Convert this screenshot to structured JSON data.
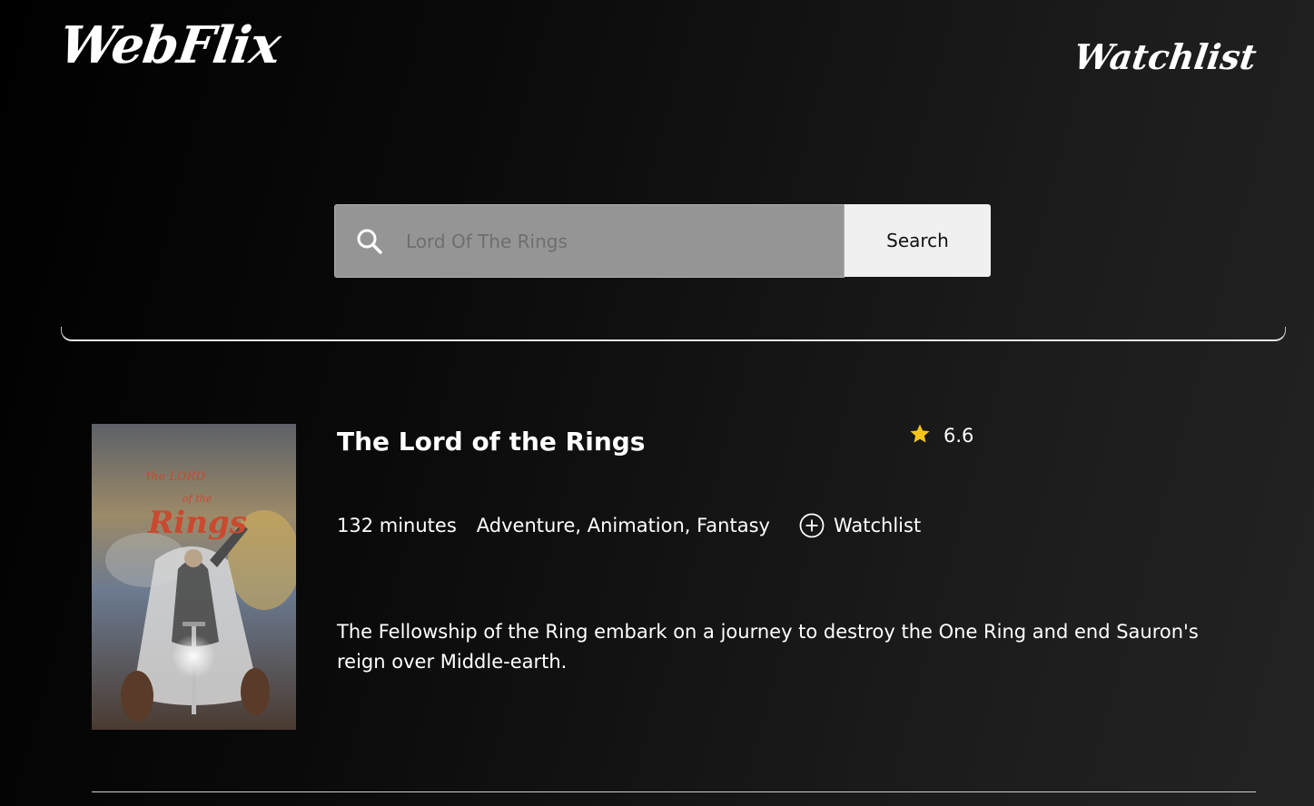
{
  "header": {
    "logo": "WebFlix",
    "watchlist_link": "Watchlist"
  },
  "search": {
    "placeholder": "Lord Of The Rings",
    "value": "",
    "button_label": "Search",
    "icon": "search-icon"
  },
  "result": {
    "poster_alt": "The Lord of the Rings poster",
    "poster_text_top": "the LORD",
    "poster_text_mid": "of the",
    "poster_text_bottom": "Rings",
    "title": "The Lord of the Rings",
    "rating": "6.6",
    "rating_icon": "star-icon",
    "runtime": "132 minutes",
    "genres": "Adventure, Animation, Fantasy",
    "watchlist_label": "Watchlist",
    "watchlist_icon": "plus-circle-icon",
    "description": "The Fellowship of the Ring embark on a journey to destroy the One Ring and end Sauron's reign over Middle-earth."
  },
  "colors": {
    "background": "#000000",
    "search_box": "#959595",
    "search_button": "#f0f0f0",
    "star": "#f5c518",
    "text": "#ffffff"
  }
}
